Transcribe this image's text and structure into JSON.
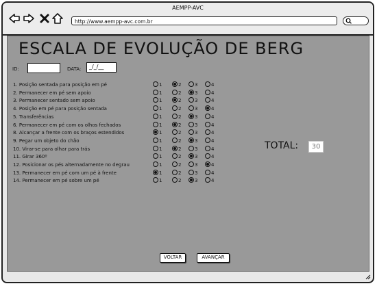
{
  "window": {
    "title": "AEMPP-AVC"
  },
  "browser": {
    "url": "http://www.aempp-avc.com.br",
    "back_icon": "arrow-left-icon",
    "forward_icon": "arrow-right-icon",
    "stop_icon": "close-icon",
    "home_icon": "home-icon",
    "search_icon": "search-icon"
  },
  "page": {
    "title": "ESCALA DE EVOLUÇÃO DE BERG",
    "id_label": "ID:",
    "id_value": "",
    "date_label": "DATA:",
    "date_value": "_/_/__",
    "option_labels": [
      "1",
      "2",
      "3",
      "4"
    ],
    "items": [
      {
        "label": "1. Posição sentada para posição em pé",
        "selected": 2
      },
      {
        "label": "2. Permanecer em pé sem apoio",
        "selected": 3
      },
      {
        "label": "3. Permanecer sentado sem apoio",
        "selected": 2
      },
      {
        "label": "4. Posição em pé para posição sentada",
        "selected": 4
      },
      {
        "label": "5. Transferências",
        "selected": 3
      },
      {
        "label": "6. Permanecer em pé com os olhos fechados",
        "selected": 2
      },
      {
        "label": "8. Alcançar a frente com os braços estendidos",
        "selected": 1
      },
      {
        "label": "9. Pegar um objeto do chão",
        "selected": 3
      },
      {
        "label": "10. Virar-se para olhar para trás",
        "selected": 2
      },
      {
        "label": "11. Girar 360º",
        "selected": 3
      },
      {
        "label": "12. Posicionar os pés alternadamente no degrau",
        "selected": 4
      },
      {
        "label": "13. Permanecer em pé com um pé à frente",
        "selected": 1
      },
      {
        "label": "14. Permanecer em pé sobre um pé",
        "selected": 3
      }
    ],
    "total_label": "TOTAL:",
    "total_value": "30",
    "back_button": "VOLTAR",
    "next_button": "AVANÇAR"
  }
}
